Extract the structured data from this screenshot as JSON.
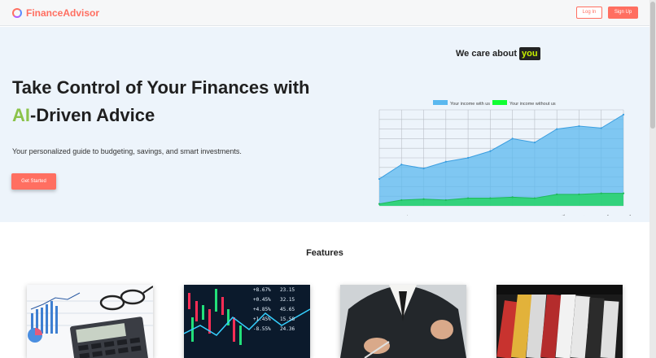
{
  "header": {
    "logo_text": "FinanceAdvisor",
    "login_label": "Log In",
    "signup_label": "Sign Up"
  },
  "hero": {
    "title_before": "Take Control of Your Finances with ",
    "title_accent": "AI",
    "title_after": "-Driven Advice",
    "subtitle": "Your personalized guide to budgeting, savings, and smart investments.",
    "cta_label": "Get Started"
  },
  "chart_heading": {
    "text": "We care about",
    "badge": "you"
  },
  "chart_data": {
    "type": "area",
    "categories": [
      "January",
      "February",
      "March",
      "April",
      "May",
      "June",
      "July",
      "August",
      "September",
      "October",
      "November",
      "December"
    ],
    "series": [
      {
        "name": "Your income with us",
        "color": "#5ab8ef",
        "values": [
          28,
          43,
          39,
          46,
          50,
          57,
          70,
          66,
          80,
          83,
          81,
          95
        ]
      },
      {
        "name": "Your income without us",
        "color": "#2bd36f",
        "values": [
          2,
          6,
          7,
          6,
          8,
          8,
          9,
          8,
          12,
          12,
          13,
          13
        ]
      }
    ],
    "ylim": [
      0,
      100
    ],
    "grid": true,
    "legend": "top",
    "slider_count": 12,
    "slider_color": "#1a73e8"
  },
  "features": {
    "title": "Features",
    "cards": [
      {
        "name": "calculator-chart-photo"
      },
      {
        "name": "stock-ticker-photo"
      },
      {
        "name": "businessman-signing-photo"
      },
      {
        "name": "wallet-cards-photo"
      }
    ]
  }
}
